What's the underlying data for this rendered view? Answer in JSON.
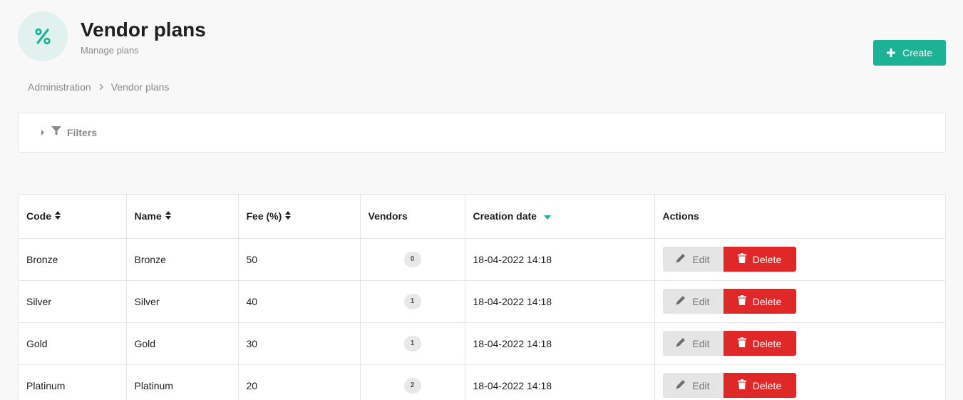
{
  "header": {
    "title": "Vendor plans",
    "subtitle": "Manage plans",
    "icon": "percent-icon",
    "accent_color": "#1bb394"
  },
  "toolbar": {
    "create_label": "Create"
  },
  "breadcrumb": {
    "items": [
      "Administration",
      "Vendor plans"
    ]
  },
  "filters": {
    "label": "Filters"
  },
  "table": {
    "columns": [
      "Code",
      "Name",
      "Fee (%)",
      "Vendors",
      "Creation date",
      "Actions"
    ],
    "sorted_by": "Creation date",
    "sort_direction": "descending",
    "rows": [
      {
        "code": "Bronze",
        "name": "Bronze",
        "fee": "50",
        "vendors": "0",
        "created": "18-04-2022 14:18"
      },
      {
        "code": "Silver",
        "name": "Silver",
        "fee": "40",
        "vendors": "1",
        "created": "18-04-2022 14:18"
      },
      {
        "code": "Gold",
        "name": "Gold",
        "fee": "30",
        "vendors": "1",
        "created": "18-04-2022 14:18"
      },
      {
        "code": "Platinum",
        "name": "Platinum",
        "fee": "20",
        "vendors": "2",
        "created": "18-04-2022 14:18"
      }
    ],
    "edit_label": "Edit",
    "delete_label": "Delete",
    "delete_color": "#e02828"
  }
}
